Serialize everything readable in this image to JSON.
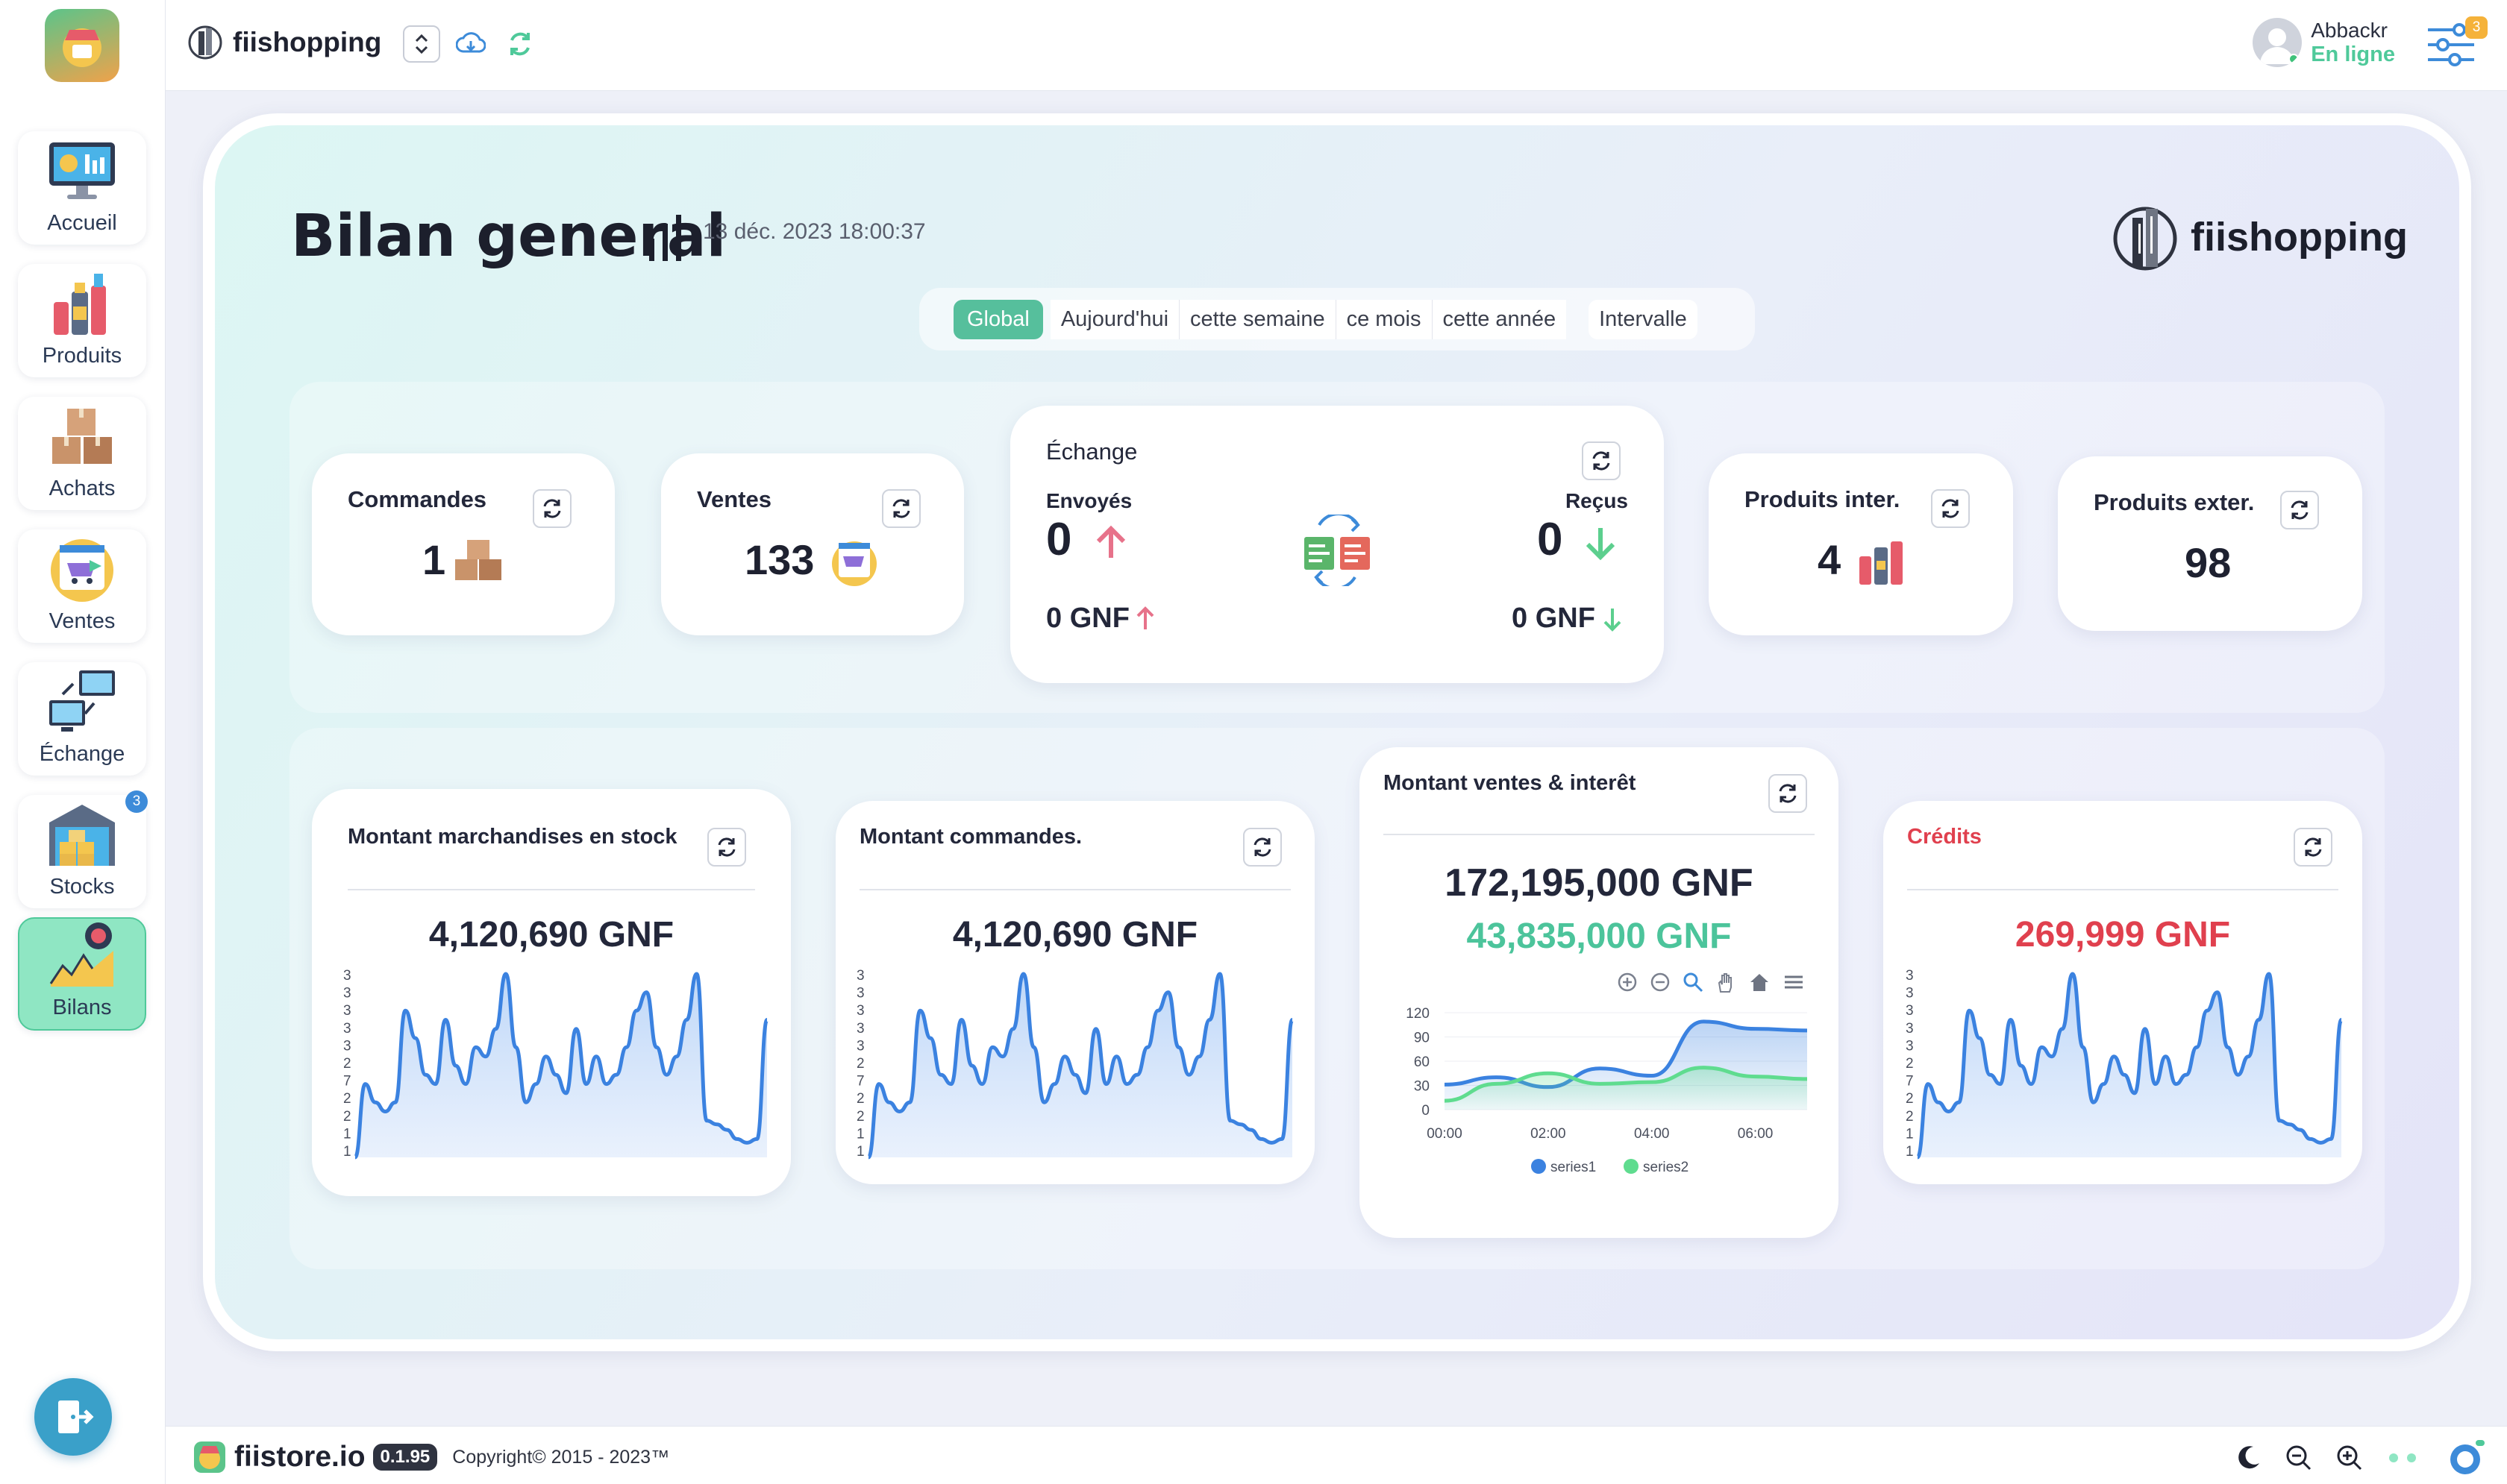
{
  "sidebar": {
    "items": [
      {
        "label": "Accueil",
        "icon": "dashboard-monitor-icon"
      },
      {
        "label": "Produits",
        "icon": "products-bottles-icon"
      },
      {
        "label": "Achats",
        "icon": "boxes-icon"
      },
      {
        "label": "Ventes",
        "icon": "cart-sales-icon"
      },
      {
        "label": "Échange",
        "icon": "exchange-computers-icon"
      },
      {
        "label": "Stocks",
        "icon": "warehouse-icon",
        "badge": "3"
      },
      {
        "label": "Bilans",
        "icon": "chart-report-icon",
        "active": true
      }
    ]
  },
  "topbar": {
    "brand": "fiishopping",
    "user_name": "Abbackr",
    "user_status": "En ligne",
    "settings_badge": "3"
  },
  "page": {
    "title": "Bilan general",
    "date": "13 déc. 2023 18:00:37",
    "brand": "fiishopping"
  },
  "filters": {
    "global": "Global",
    "options": [
      "Aujourd'hui",
      "cette semaine",
      "ce mois",
      "cette année"
    ],
    "interval": "Intervalle",
    "active": "Global"
  },
  "stats": {
    "commandes": {
      "title": "Commandes",
      "value": "1"
    },
    "ventes": {
      "title": "Ventes",
      "value": "133"
    },
    "echange": {
      "title": "Échange",
      "sent_label": "Envoyés",
      "sent_value": "0",
      "received_label": "Reçus",
      "received_value": "0",
      "sent_gnf": "0 GNF",
      "received_gnf": "0 GNF"
    },
    "produits_inter": {
      "title": "Produits inter.",
      "value": "4"
    },
    "produits_exter": {
      "title": "Produits exter.",
      "value": "98"
    }
  },
  "amounts": {
    "stock": {
      "title": "Montant marchandises en stock",
      "value": "4,120,690 GNF"
    },
    "commandes": {
      "title": "Montant commandes.",
      "value": "4,120,690 GNF"
    },
    "ventes": {
      "title": "Montant ventes & interêt",
      "value": "172,195,000 GNF",
      "interest": "43,835,000 GNF"
    },
    "credits": {
      "title": "Crédits",
      "value": "269,999 GNF"
    }
  },
  "colors": {
    "accent_green": "#4cc49b",
    "credit_red": "#e0404e",
    "line_blue": "#3b82e0",
    "series2_green": "#5fdc8f"
  },
  "chart_data": [
    {
      "type": "area",
      "title": "Montant marchandises en stock",
      "y_tick_labels": [
        "3",
        "3",
        "3",
        "3",
        "3",
        "2",
        "7",
        "2",
        "2",
        "1",
        "1"
      ],
      "series": [
        {
          "values": [
            0,
            40,
            30,
            25,
            30,
            80,
            65,
            45,
            40,
            75,
            50,
            40,
            60,
            55,
            70,
            100,
            60,
            30,
            40,
            55,
            45,
            35,
            70,
            40,
            55,
            40,
            45,
            60,
            80,
            90,
            60,
            45,
            55,
            75,
            100,
            20,
            18,
            15,
            10,
            8,
            10,
            75
          ]
        }
      ]
    },
    {
      "type": "area",
      "title": "Montant commandes.",
      "y_tick_labels": [
        "3",
        "3",
        "3",
        "3",
        "3",
        "2",
        "7",
        "2",
        "2",
        "1",
        "1"
      ],
      "series": [
        {
          "values": [
            0,
            40,
            30,
            25,
            30,
            80,
            65,
            45,
            40,
            75,
            50,
            40,
            60,
            55,
            70,
            100,
            60,
            30,
            40,
            55,
            45,
            35,
            70,
            40,
            55,
            40,
            45,
            60,
            80,
            90,
            60,
            45,
            55,
            75,
            100,
            20,
            18,
            15,
            10,
            8,
            10,
            75
          ]
        }
      ]
    },
    {
      "type": "area",
      "title": "Montant ventes & interêt",
      "x": [
        "00:00",
        "01:00",
        "02:00",
        "03:00",
        "04:00",
        "05:00",
        "06:00",
        "06:30"
      ],
      "x_ticks": [
        "00:00",
        "02:00",
        "04:00",
        "06:00"
      ],
      "ylim": [
        0,
        120
      ],
      "y_ticks": [
        0,
        30,
        60,
        90,
        120
      ],
      "series": [
        {
          "name": "series1",
          "values": [
            31,
            40,
            28,
            51,
            42,
            109,
            100,
            98
          ]
        },
        {
          "name": "series2",
          "values": [
            11,
            32,
            45,
            32,
            34,
            52,
            41,
            38
          ]
        }
      ],
      "legend": "bottom"
    },
    {
      "type": "area",
      "title": "Crédits",
      "y_tick_labels": [
        "3",
        "3",
        "3",
        "3",
        "3",
        "2",
        "7",
        "2",
        "2",
        "1",
        "1"
      ],
      "series": [
        {
          "values": [
            0,
            40,
            30,
            25,
            30,
            80,
            65,
            45,
            40,
            75,
            50,
            40,
            60,
            55,
            70,
            100,
            60,
            30,
            40,
            55,
            45,
            35,
            70,
            40,
            55,
            40,
            45,
            60,
            80,
            90,
            60,
            45,
            55,
            75,
            100,
            20,
            18,
            15,
            10,
            8,
            10,
            75
          ]
        }
      ]
    }
  ],
  "footer": {
    "brand": "fiistore.io",
    "version": "0.1.95",
    "copyright": "Copyright© 2015 - 2023™"
  }
}
